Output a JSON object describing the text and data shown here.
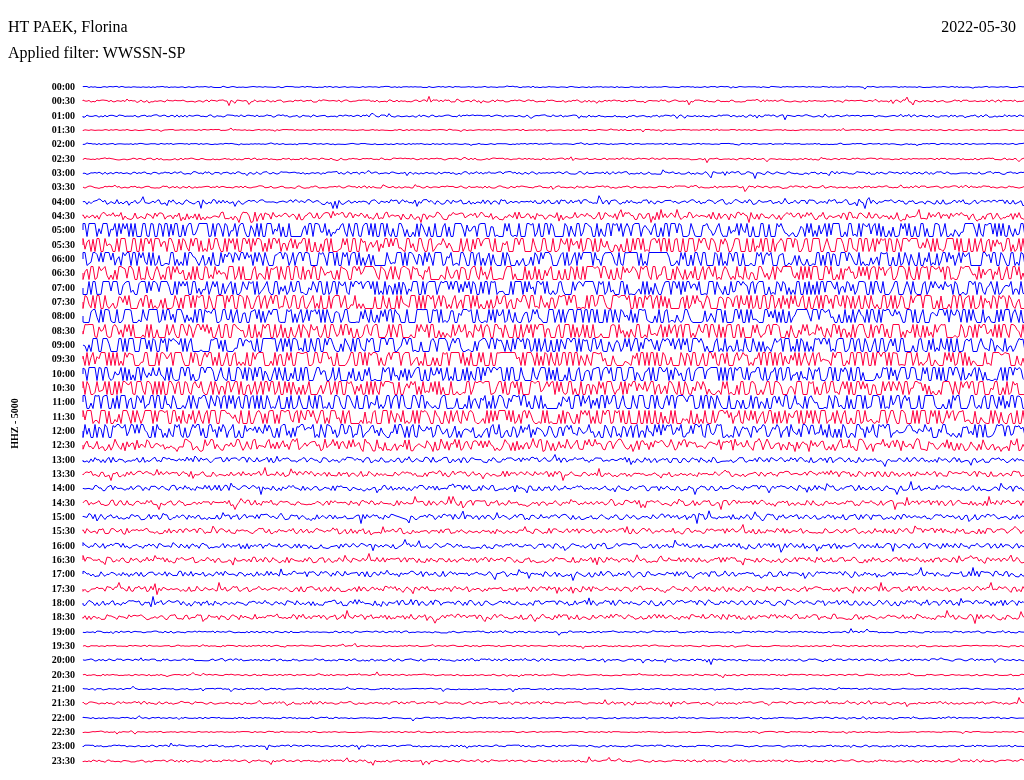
{
  "title": "HT PAEK, Florina",
  "date": "2022-05-30",
  "filter": "Applied filter: WWSSN-SP",
  "axis_label": "HHZ - 5000",
  "rows": [
    {
      "label": "00:00",
      "color": "#0000ff"
    },
    {
      "label": "00:30",
      "color": "#ff0040"
    },
    {
      "label": "01:00",
      "color": "#0000ff"
    },
    {
      "label": "01:30",
      "color": "#ff0040"
    },
    {
      "label": "02:00",
      "color": "#0000ff"
    },
    {
      "label": "02:30",
      "color": "#ff0040"
    },
    {
      "label": "03:00",
      "color": "#0000ff"
    },
    {
      "label": "03:30",
      "color": "#ff0040"
    },
    {
      "label": "04:00",
      "color": "#0000ff"
    },
    {
      "label": "04:30",
      "color": "#ff0040"
    },
    {
      "label": "05:00",
      "color": "#0000ff"
    },
    {
      "label": "05:30",
      "color": "#ff0040"
    },
    {
      "label": "06:00",
      "color": "#0000ff"
    },
    {
      "label": "06:30",
      "color": "#ff0040"
    },
    {
      "label": "07:00",
      "color": "#0000ff"
    },
    {
      "label": "07:30",
      "color": "#ff0040"
    },
    {
      "label": "08:00",
      "color": "#0000ff"
    },
    {
      "label": "08:30",
      "color": "#ff0040"
    },
    {
      "label": "09:00",
      "color": "#0000ff"
    },
    {
      "label": "09:30",
      "color": "#ff0040"
    },
    {
      "label": "10:00",
      "color": "#0000ff"
    },
    {
      "label": "10:30",
      "color": "#ff0040"
    },
    {
      "label": "11:00",
      "color": "#0000ff"
    },
    {
      "label": "11:30",
      "color": "#ff0040"
    },
    {
      "label": "12:00",
      "color": "#0000ff"
    },
    {
      "label": "12:30",
      "color": "#ff0040"
    },
    {
      "label": "13:00",
      "color": "#0000ff"
    },
    {
      "label": "13:30",
      "color": "#ff0040"
    },
    {
      "label": "14:00",
      "color": "#0000ff"
    },
    {
      "label": "14:30",
      "color": "#ff0040"
    },
    {
      "label": "15:00",
      "color": "#0000ff"
    },
    {
      "label": "15:30",
      "color": "#ff0040"
    },
    {
      "label": "16:00",
      "color": "#0000ff"
    },
    {
      "label": "16:30",
      "color": "#ff0040"
    },
    {
      "label": "17:00",
      "color": "#0000ff"
    },
    {
      "label": "17:30",
      "color": "#ff0040"
    },
    {
      "label": "18:00",
      "color": "#0000ff"
    },
    {
      "label": "18:30",
      "color": "#ff0040"
    },
    {
      "label": "19:00",
      "color": "#0000ff"
    },
    {
      "label": "19:30",
      "color": "#ff0040"
    },
    {
      "label": "20:00",
      "color": "#0000ff"
    },
    {
      "label": "20:30",
      "color": "#ff0040"
    },
    {
      "label": "21:00",
      "color": "#0000ff"
    },
    {
      "label": "21:30",
      "color": "#ff0040"
    },
    {
      "label": "22:00",
      "color": "#0000ff"
    },
    {
      "label": "22:30",
      "color": "#ff0040"
    },
    {
      "label": "23:00",
      "color": "#0000ff"
    },
    {
      "label": "23:30",
      "color": "#ff0040"
    }
  ]
}
